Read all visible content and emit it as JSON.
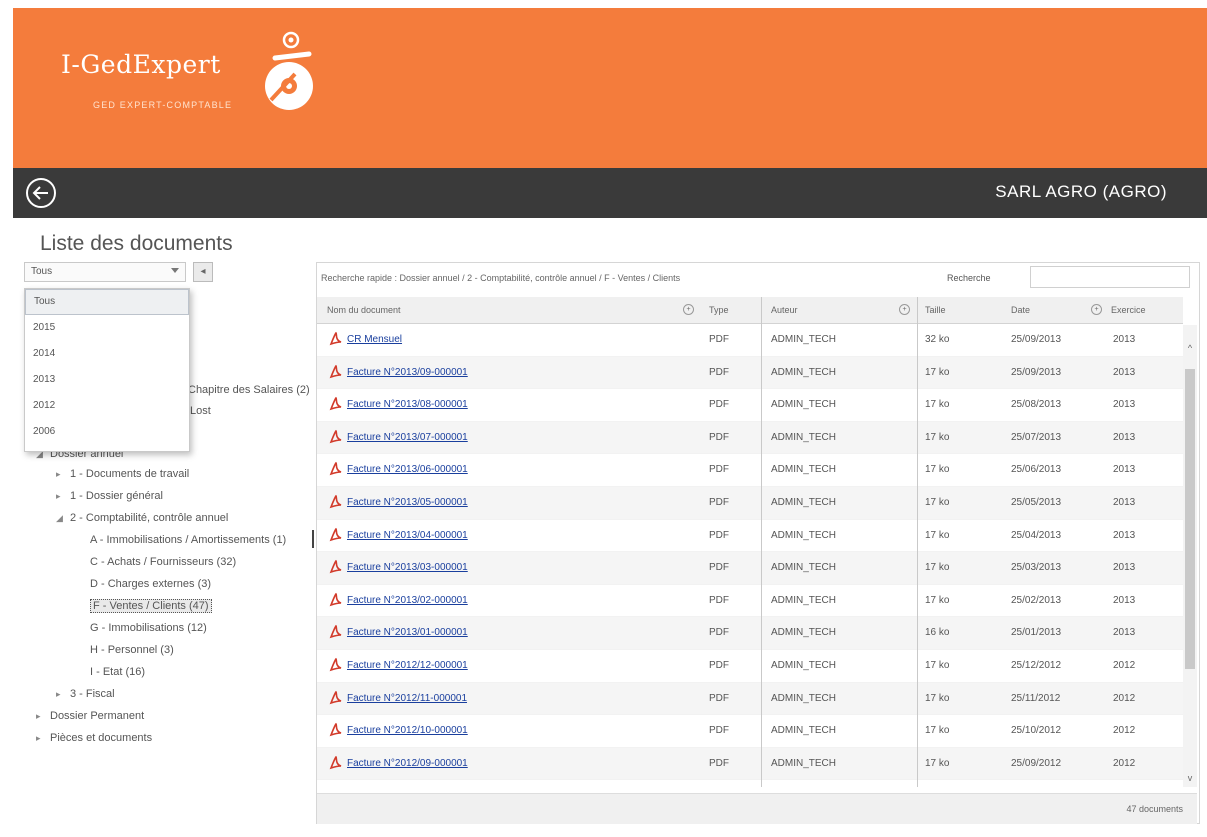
{
  "app": {
    "name": "I-GedExpert",
    "tagline": "GED EXPERT-COMPTABLE"
  },
  "navbar": {
    "company": "SARL AGRO (AGRO)"
  },
  "page": {
    "title": "Liste des documents"
  },
  "filter": {
    "selected": "Tous",
    "options": [
      "Tous",
      "2015",
      "2014",
      "2013",
      "2012",
      "2006"
    ]
  },
  "tree": {
    "n1": "Chapitre des Salaires (2)",
    "n2": "Lost",
    "n3": "Dossier annuel",
    "n4": "1 - Documents de travail",
    "n5": "1 - Dossier général",
    "n6": "2 - Comptabilité, contrôle annuel",
    "n7": "A - Immobilisations / Amortissements (1)",
    "n8": "C - Achats / Fournisseurs (32)",
    "n9": "D - Charges externes (3)",
    "n10": "F - Ventes / Clients (47)",
    "n11": "G - Immobilisations (12)",
    "n12": "H - Personnel (3)",
    "n13": "I - Etat (16)",
    "n14": "3 - Fiscal",
    "n15": "Dossier Permanent",
    "n16": "Pièces et documents"
  },
  "right": {
    "breadcrumb": "Recherche rapide : Dossier annuel / 2 - Comptabilité, contrôle annuel / F - Ventes / Clients",
    "search_label": "Recherche"
  },
  "grid": {
    "headers": {
      "name": "Nom du document",
      "type": "Type",
      "author": "Auteur",
      "size": "Taille",
      "date": "Date",
      "year": "Exercice"
    },
    "rows": [
      {
        "name": "CR Mensuel",
        "type": "PDF",
        "author": "ADMIN_TECH",
        "size": "32 ko",
        "date": "25/09/2013",
        "year": "2013"
      },
      {
        "name": "Facture N°2013/09-000001",
        "type": "PDF",
        "author": "ADMIN_TECH",
        "size": "17 ko",
        "date": "25/09/2013",
        "year": "2013"
      },
      {
        "name": "Facture N°2013/08-000001",
        "type": "PDF",
        "author": "ADMIN_TECH",
        "size": "17 ko",
        "date": "25/08/2013",
        "year": "2013"
      },
      {
        "name": "Facture N°2013/07-000001",
        "type": "PDF",
        "author": "ADMIN_TECH",
        "size": "17 ko",
        "date": "25/07/2013",
        "year": "2013"
      },
      {
        "name": "Facture N°2013/06-000001",
        "type": "PDF",
        "author": "ADMIN_TECH",
        "size": "17 ko",
        "date": "25/06/2013",
        "year": "2013"
      },
      {
        "name": "Facture N°2013/05-000001",
        "type": "PDF",
        "author": "ADMIN_TECH",
        "size": "17 ko",
        "date": "25/05/2013",
        "year": "2013"
      },
      {
        "name": "Facture N°2013/04-000001",
        "type": "PDF",
        "author": "ADMIN_TECH",
        "size": "17 ko",
        "date": "25/04/2013",
        "year": "2013"
      },
      {
        "name": "Facture N°2013/03-000001",
        "type": "PDF",
        "author": "ADMIN_TECH",
        "size": "17 ko",
        "date": "25/03/2013",
        "year": "2013"
      },
      {
        "name": "Facture N°2013/02-000001",
        "type": "PDF",
        "author": "ADMIN_TECH",
        "size": "17 ko",
        "date": "25/02/2013",
        "year": "2013"
      },
      {
        "name": "Facture N°2013/01-000001",
        "type": "PDF",
        "author": "ADMIN_TECH",
        "size": "16 ko",
        "date": "25/01/2013",
        "year": "2013"
      },
      {
        "name": "Facture N°2012/12-000001",
        "type": "PDF",
        "author": "ADMIN_TECH",
        "size": "17 ko",
        "date": "25/12/2012",
        "year": "2012"
      },
      {
        "name": "Facture N°2012/11-000001",
        "type": "PDF",
        "author": "ADMIN_TECH",
        "size": "17 ko",
        "date": "25/11/2012",
        "year": "2012"
      },
      {
        "name": "Facture N°2012/10-000001",
        "type": "PDF",
        "author": "ADMIN_TECH",
        "size": "17 ko",
        "date": "25/10/2012",
        "year": "2012"
      },
      {
        "name": "Facture N°2012/09-000001",
        "type": "PDF",
        "author": "ADMIN_TECH",
        "size": "17 ko",
        "date": "25/09/2012",
        "year": "2012"
      }
    ]
  },
  "footer": {
    "count": "47 documents"
  },
  "colors": {
    "header": "#f47c3c",
    "navbar": "#3a3a3a",
    "link": "#1a3f9e"
  }
}
